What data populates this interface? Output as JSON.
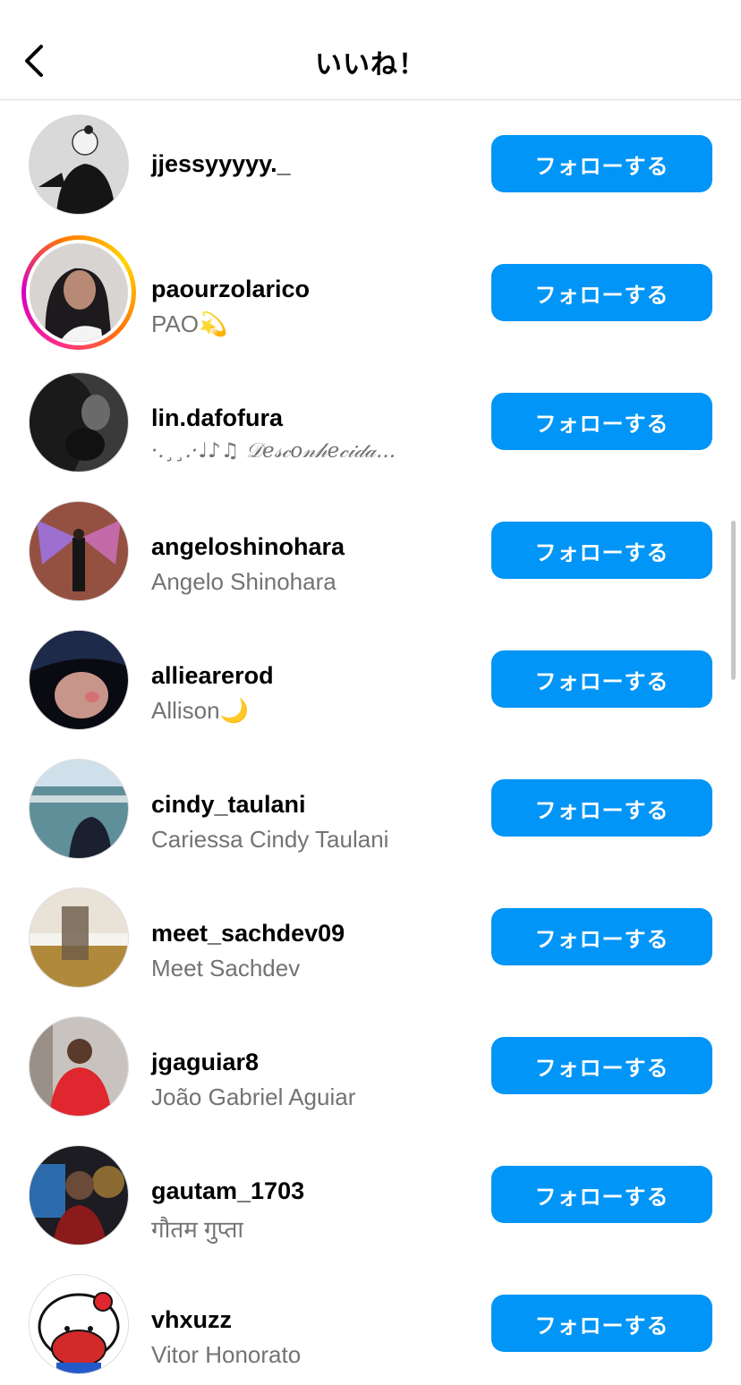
{
  "header": {
    "title": "いいね！",
    "back_icon": "chevron-left-icon"
  },
  "accent_color": "#0095f6",
  "follow_label": "フォローする",
  "users": [
    {
      "username": "jjessyyyyy._",
      "fullname": ""
    },
    {
      "username": "paourzolarico",
      "fullname": "PAO💫",
      "has_story": true
    },
    {
      "username": "lin.dafofura",
      "fullname": "·.¸¸.·♩♪♫ 𝒟𝑒𝓈𝒸𝑜𝓃𝒽𝑒𝒸𝒾𝒹𝒶..."
    },
    {
      "username": "angeloshinohara",
      "fullname": "Angelo Shinohara"
    },
    {
      "username": "alliearerod",
      "fullname": "Allison🌙"
    },
    {
      "username": "cindy_taulani",
      "fullname": "Cariessa Cindy Taulani"
    },
    {
      "username": "meet_sachdev09",
      "fullname": "Meet Sachdev"
    },
    {
      "username": "jgaguiar8",
      "fullname": "João Gabriel Aguiar"
    },
    {
      "username": "gautam_1703",
      "fullname": "गौतम गुप्ता"
    },
    {
      "username": "vhxuzz",
      "fullname": "Vitor Honorato"
    }
  ]
}
